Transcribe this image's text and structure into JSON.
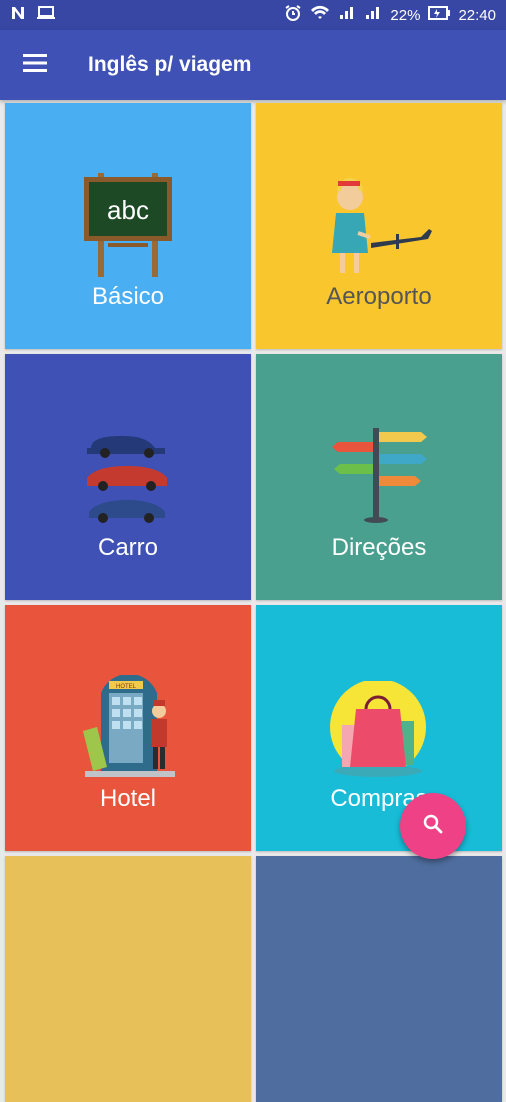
{
  "status_bar": {
    "battery": "22%",
    "time": "22:40"
  },
  "app_bar": {
    "title": "Inglês p/ viagem"
  },
  "tiles": [
    {
      "label": "Básico",
      "color": "#4aaef3",
      "text_color": "#ffffff"
    },
    {
      "label": "Aeroporto",
      "color": "#fac62e",
      "text_color": "#555555"
    },
    {
      "label": "Carro",
      "color": "#3f51b5",
      "text_color": "#ffffff"
    },
    {
      "label": "Direções",
      "color": "#4aa08f",
      "text_color": "#ffffff"
    },
    {
      "label": "Hotel",
      "color": "#e8553c",
      "text_color": "#ffffff"
    },
    {
      "label": "Compras",
      "color": "#18bcd7",
      "text_color": "#ffffff"
    },
    {
      "label": "",
      "color": "#e8c05a"
    },
    {
      "label": "",
      "color": "#4f6d9e"
    }
  ],
  "chalkboard_text": "abc",
  "hotel_sign": "HOTEL",
  "fab": {
    "icon": "search-icon",
    "color": "#ef4185"
  }
}
